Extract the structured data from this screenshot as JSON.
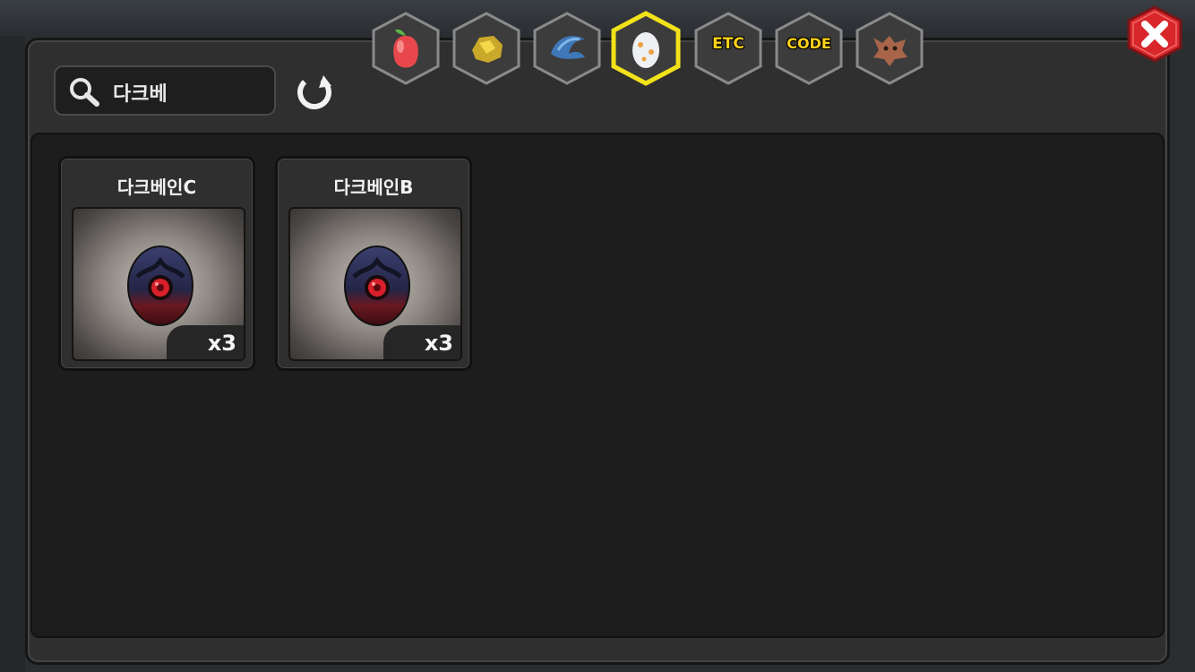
{
  "search": {
    "value": "다크베"
  },
  "tabs": [
    {
      "name": "fruit-tab",
      "icon": "fruit-icon"
    },
    {
      "name": "ore-tab",
      "icon": "ore-icon"
    },
    {
      "name": "claw-tab",
      "icon": "claw-icon"
    },
    {
      "name": "egg-tab",
      "icon": "egg-icon",
      "selected": true
    },
    {
      "name": "etc-tab",
      "label": "ETC"
    },
    {
      "name": "code-tab",
      "label": "CODE"
    },
    {
      "name": "dragon-tab",
      "icon": "dragon-icon"
    }
  ],
  "items": [
    {
      "name": "다크베인C",
      "count": "x3",
      "icon": "dark-egg-icon"
    },
    {
      "name": "다크베인B",
      "count": "x3",
      "icon": "dark-egg-icon"
    }
  ],
  "colors": {
    "tab_selected_border": "#f2e21a",
    "tab_label": "#ffd21a",
    "close_button": "#d8262a"
  }
}
